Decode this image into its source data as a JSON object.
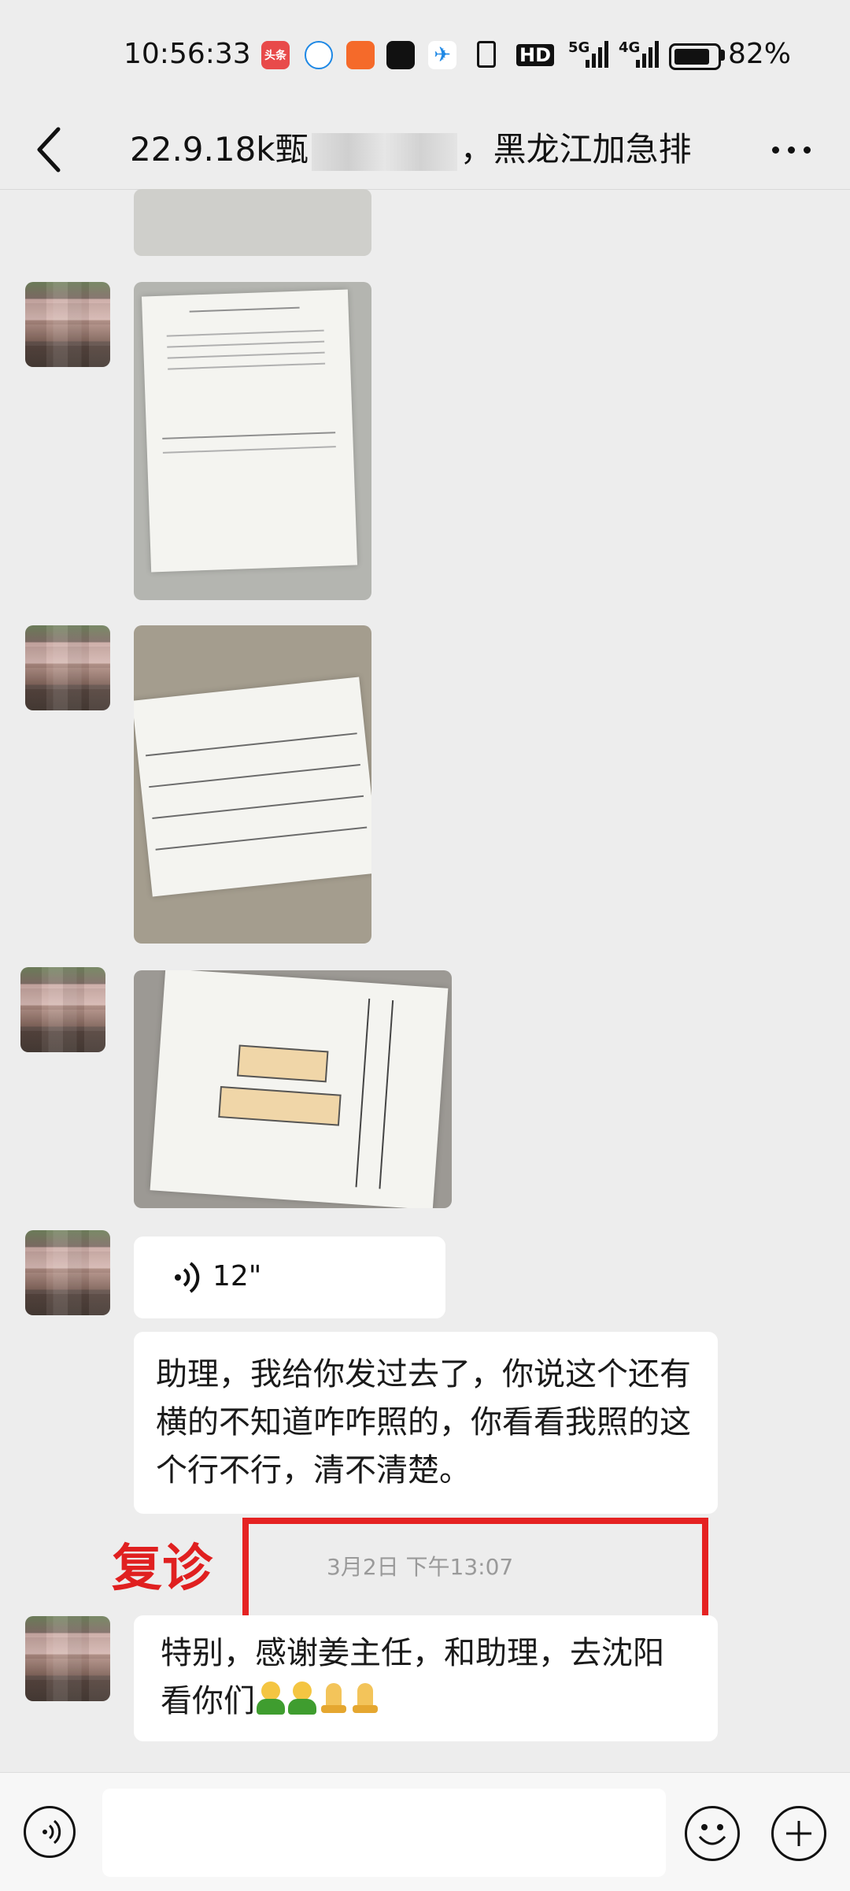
{
  "status_bar": {
    "time": "10:56:33",
    "notif_toutiao": "头条",
    "battery_percent": "82%",
    "net_5g": "5G",
    "net_4g": "4G",
    "hd_label": "HD"
  },
  "header": {
    "title_prefix": "22.9.18k甄",
    "title_suffix": "，黑龙江加急排"
  },
  "messages": {
    "voice_duration": "12\"",
    "text_1": "助理，我给你发过去了，你说这个还有横的不知道咋咋照的，你看看我照的这个行不行，清不清楚。",
    "timestamp": "3月2日 下午13:07",
    "annotation_label": "复诊",
    "text_2": "特别，感谢姜主任，和助理，去沈阳看你们"
  },
  "icons": {
    "back": "chevron-left-icon",
    "more": "more-horizontal-icon",
    "voice": "voice-icon",
    "emoji": "emoji-icon",
    "plus": "plus-icon"
  },
  "colors": {
    "background": "#ededed",
    "bubble": "#ffffff",
    "annotation_red": "#e52222",
    "timestamp_gray": "#9a9a9a"
  }
}
